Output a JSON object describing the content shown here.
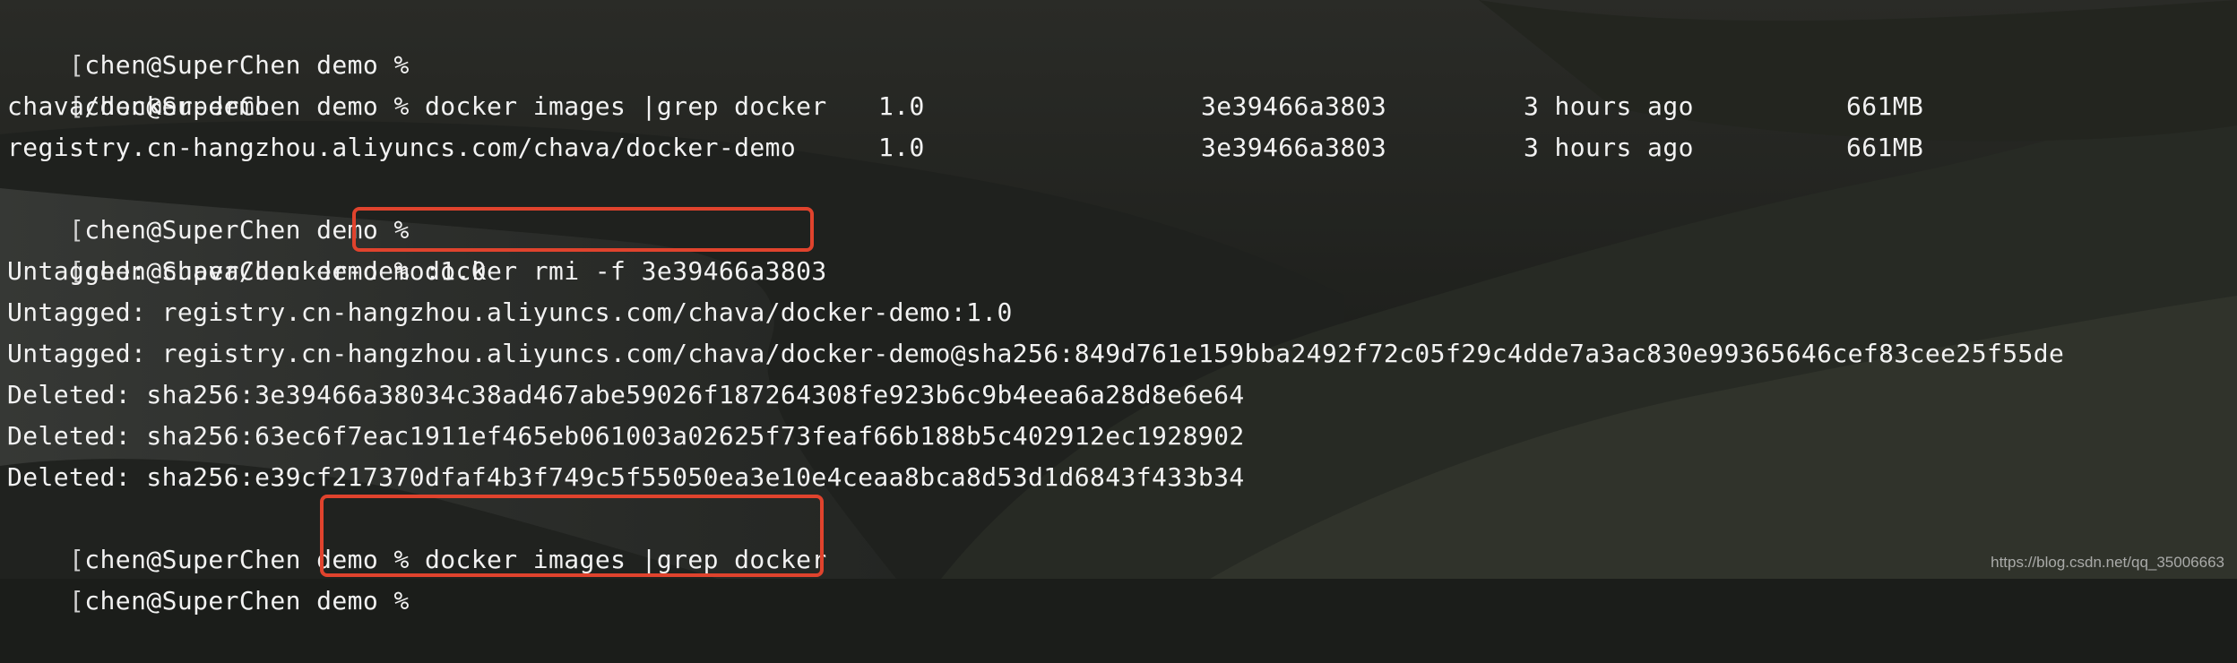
{
  "terminal": {
    "lines": [
      {
        "prompt": "chen@SuperChen demo %",
        "command": ""
      },
      {
        "prompt": "chen@SuperChen demo %",
        "command": " docker images |grep docker"
      },
      {
        "repository": "chava/docker-demo",
        "tag": "1.0",
        "image_id": "3e39466a3803",
        "created": "3 hours ago",
        "size": "661MB"
      },
      {
        "repository": "registry.cn-hangzhou.aliyuncs.com/chava/docker-demo",
        "tag": "1.0",
        "image_id": "3e39466a3803",
        "created": "3 hours ago",
        "size": "661MB"
      },
      {
        "prompt": "chen@SuperChen demo %",
        "command": ""
      },
      {
        "prompt": "chen@SuperChen demo %",
        "command": " docker rmi -f 3e39466a3803"
      },
      {
        "text": "Untagged: chava/docker-demo:1.0"
      },
      {
        "text": "Untagged: registry.cn-hangzhou.aliyuncs.com/chava/docker-demo:1.0"
      },
      {
        "text": "Untagged: registry.cn-hangzhou.aliyuncs.com/chava/docker-demo@sha256:849d761e159bba2492f72c05f29c4dde7a3ac830e99365646cef83cee25f55de"
      },
      {
        "text": "Deleted: sha256:3e39466a38034c38ad467abe59026f187264308fe923b6c9b4eea6a28d8e6e64"
      },
      {
        "text": "Deleted: sha256:63ec6f7eac1911ef465eb061003a02625f73feaf66b188b5c402912ec1928902"
      },
      {
        "text": "Deleted: sha256:e39cf217370dfaf4b3f749c5f55050ea3e10e4ceaa8bca8d53d1d6843f433b34"
      },
      {
        "prompt": "chen@SuperChen demo",
        "command": "% docker images |grep docker"
      },
      {
        "prompt": "chen@SuperChen demo",
        "command": "%"
      }
    ]
  },
  "watermark": "https://blog.csdn.net/qq_35006663",
  "colors": {
    "highlight_border": "#e0432d",
    "text": "#f2f2f2",
    "background": "#1b1d1a"
  }
}
